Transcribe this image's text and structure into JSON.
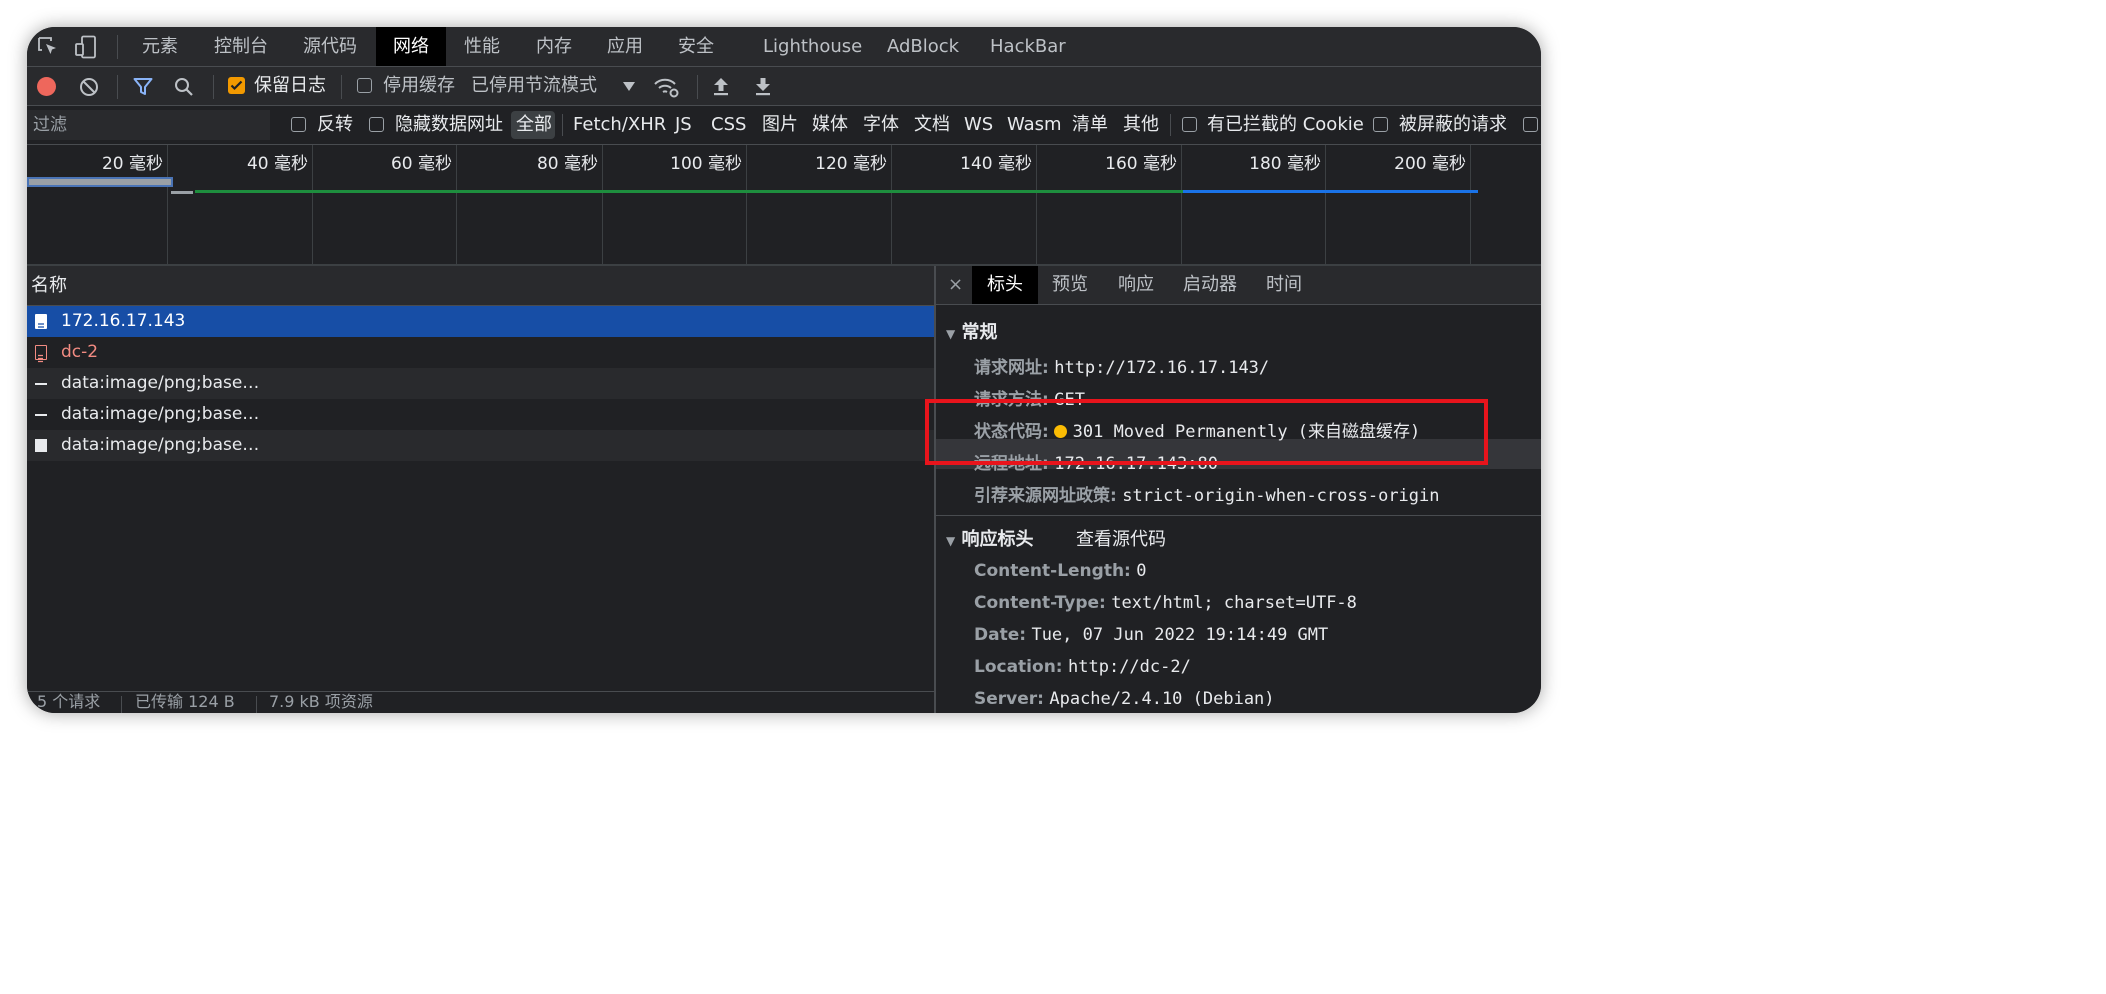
{
  "tabs": [
    "元素",
    "控制台",
    "源代码",
    "网络",
    "性能",
    "内存",
    "应用",
    "安全",
    "Lighthouse",
    "AdBlock",
    "HackBar"
  ],
  "toolbar": {
    "preserve_log": "保留日志",
    "disable_cache": "停用缓存",
    "throttling": "已停用节流模式"
  },
  "filter": {
    "placeholder": "过滤",
    "invert": "反转",
    "hide_data_urls": "隐藏数据网址",
    "types": [
      "全部",
      "Fetch/XHR",
      "JS",
      "CSS",
      "图片",
      "媒体",
      "字体",
      "文档",
      "WS",
      "Wasm",
      "清单",
      "其他"
    ],
    "blocked_cookies": "有已拦截的 Cookie",
    "blocked_requests": "被屏蔽的请求"
  },
  "timeline": {
    "ticks": [
      "20 毫秒",
      "40 毫秒",
      "60 毫秒",
      "80 毫秒",
      "100 毫秒",
      "120 毫秒",
      "140 毫秒",
      "160 毫秒",
      "180 毫秒",
      "200 毫秒"
    ]
  },
  "list": {
    "header": "名称",
    "rows": [
      "172.16.17.143",
      "dc-2",
      "data:image/png;base…",
      "data:image/png;base…",
      "data:image/png;base…"
    ],
    "status": [
      "5 个请求",
      "已传输 124 B",
      "7.9 kB 项资源"
    ]
  },
  "detail": {
    "tabs": [
      "标头",
      "预览",
      "响应",
      "启动器",
      "时间"
    ],
    "general": {
      "title": "常规",
      "items": [
        {
          "k": "请求网址:",
          "v": "http://172.16.17.143/"
        },
        {
          "k": "请求方法:",
          "v": "GET"
        },
        {
          "k": "状态代码:",
          "v": "301 Moved Permanently (来自磁盘缓存)"
        },
        {
          "k": "远程地址:",
          "v": "172.16.17.143:80"
        },
        {
          "k": "引荐来源网址政策:",
          "v": "strict-origin-when-cross-origin"
        }
      ]
    },
    "response": {
      "title": "响应标头",
      "view_source": "查看源代码",
      "items": [
        {
          "k": "Content-Length:",
          "v": "0"
        },
        {
          "k": "Content-Type:",
          "v": "text/html; charset=UTF-8"
        },
        {
          "k": "Date:",
          "v": "Tue, 07 Jun 2022 19:14:49 GMT"
        },
        {
          "k": "Location:",
          "v": "http://dc-2/"
        },
        {
          "k": "Server:",
          "v": "Apache/2.4.10 (Debian)"
        }
      ]
    }
  },
  "colors": {
    "accent": "#8ab4f8",
    "selected_row": "#174ea6",
    "error": "#f28b82",
    "record": "#ee675c",
    "highlight": "#e8141c",
    "status_dot": "#fbbc04"
  }
}
